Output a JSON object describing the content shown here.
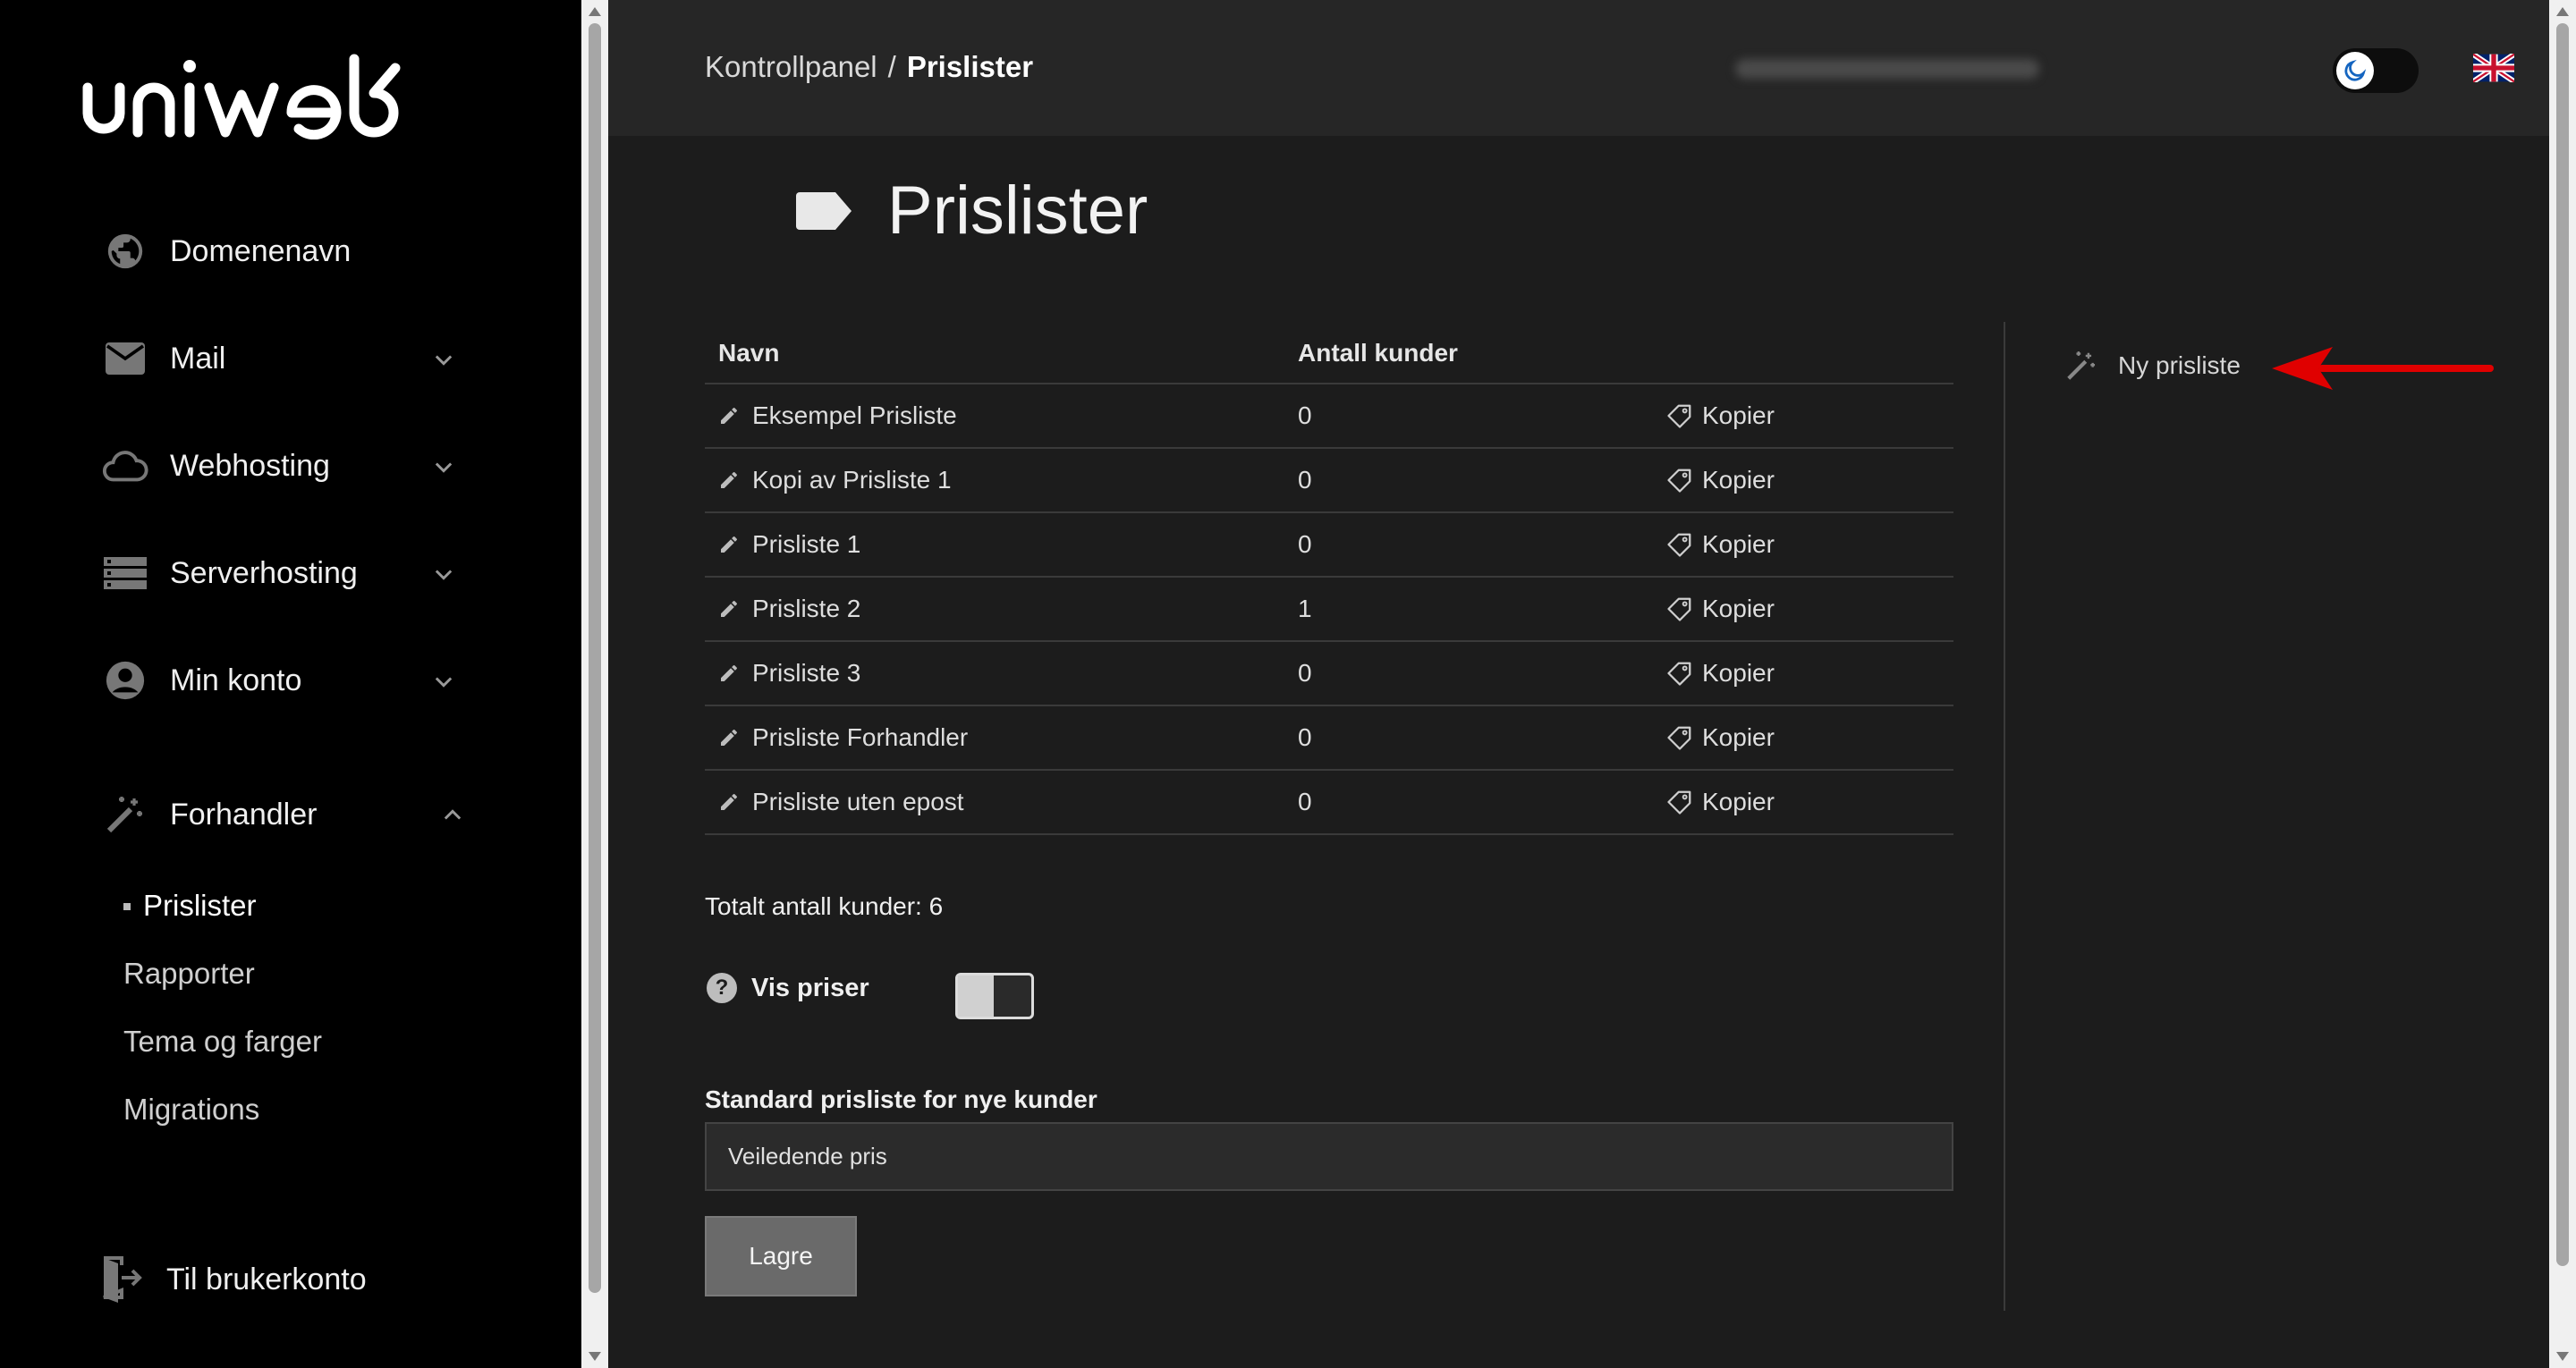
{
  "sidebar": {
    "logo_text": "uniweb",
    "items": [
      {
        "label": "Domenenavn",
        "icon": "globe-icon",
        "has_chevron": false
      },
      {
        "label": "Mail",
        "icon": "envelope-icon",
        "has_chevron": true
      },
      {
        "label": "Webhosting",
        "icon": "cloud-icon",
        "has_chevron": true
      },
      {
        "label": "Serverhosting",
        "icon": "server-icon",
        "has_chevron": true
      },
      {
        "label": "Min konto",
        "icon": "account-circle-icon",
        "has_chevron": true
      },
      {
        "label": "Forhandler",
        "icon": "magic-wand-icon",
        "expanded": true
      }
    ],
    "subitems": [
      {
        "label": "Prislister",
        "active": true
      },
      {
        "label": "Rapporter"
      },
      {
        "label": "Tema og farger"
      },
      {
        "label": "Migrations"
      }
    ],
    "exit_label": "Til brukerkonto"
  },
  "topbar": {
    "breadcrumb_root": "Kontrollpanel",
    "breadcrumb_sep": "/",
    "breadcrumb_current": "Prislister",
    "theme": "dark",
    "language_flag": "uk-flag-icon"
  },
  "page": {
    "title": "Prislister",
    "title_icon": "label-tag-icon"
  },
  "table": {
    "headers": {
      "name": "Navn",
      "count": "Antall kunder"
    },
    "rows": [
      {
        "name": "Eksempel Prisliste",
        "count": "0",
        "action": "Kopier"
      },
      {
        "name": "Kopi av Prisliste 1",
        "count": "0",
        "action": "Kopier"
      },
      {
        "name": "Prisliste 1",
        "count": "0",
        "action": "Kopier"
      },
      {
        "name": "Prisliste 2",
        "count": "1",
        "action": "Kopier"
      },
      {
        "name": "Prisliste 3",
        "count": "0",
        "action": "Kopier"
      },
      {
        "name": "Prisliste Forhandler",
        "count": "0",
        "action": "Kopier"
      },
      {
        "name": "Prisliste uten epost",
        "count": "0",
        "action": "Kopier"
      }
    ]
  },
  "total_label": "Totalt antall kunder: 6",
  "show_prices": {
    "label": "Vis priser",
    "enabled": false
  },
  "default_pricelist": {
    "label": "Standard prisliste for nye kunder",
    "value": "Veiledende pris"
  },
  "save_label": "Lagre",
  "new_pricelist_label": "Ny prisliste",
  "colors": {
    "sidebar_bg": "#000000",
    "main_bg": "#1c1c1c",
    "topbar_bg": "#262626",
    "annotation_arrow": "#e00000"
  }
}
